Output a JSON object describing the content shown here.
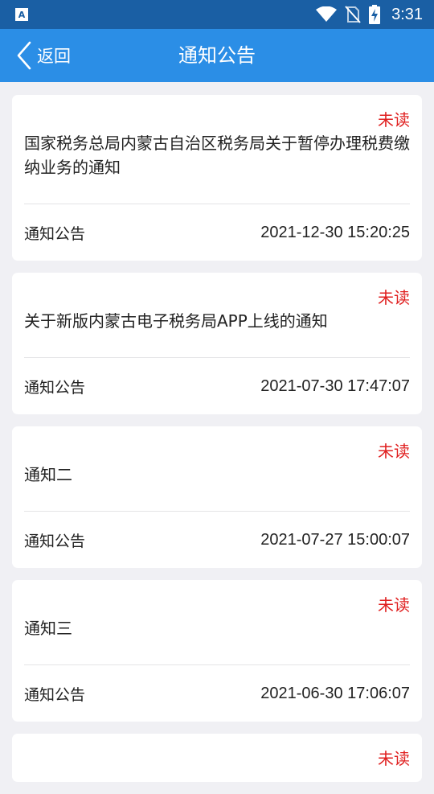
{
  "status_bar": {
    "time": "3:31",
    "icons": [
      "app-notification-icon",
      "wifi-icon",
      "no-sim-icon",
      "battery-charging-icon"
    ]
  },
  "header": {
    "back_label": "返回",
    "title": "通知公告"
  },
  "notices": [
    {
      "status": "未读",
      "title": "国家税务总局内蒙古自治区税务局关于暂停办理税费缴纳业务的通知",
      "category": "通知公告",
      "date": "2021-12-30 15:20:25"
    },
    {
      "status": "未读",
      "title": "关于新版内蒙古电子税务局APP上线的通知",
      "category": "通知公告",
      "date": "2021-07-30 17:47:07"
    },
    {
      "status": "未读",
      "title": "通知二",
      "category": "通知公告",
      "date": "2021-07-27 15:00:07"
    },
    {
      "status": "未读",
      "title": "通知三",
      "category": "通知公告",
      "date": "2021-06-30 17:06:07"
    },
    {
      "status": "未读"
    }
  ],
  "colors": {
    "status_bar": "#1a5fa4",
    "header": "#2b8ee6",
    "unread": "#e02020",
    "background": "#f0f0f4"
  }
}
